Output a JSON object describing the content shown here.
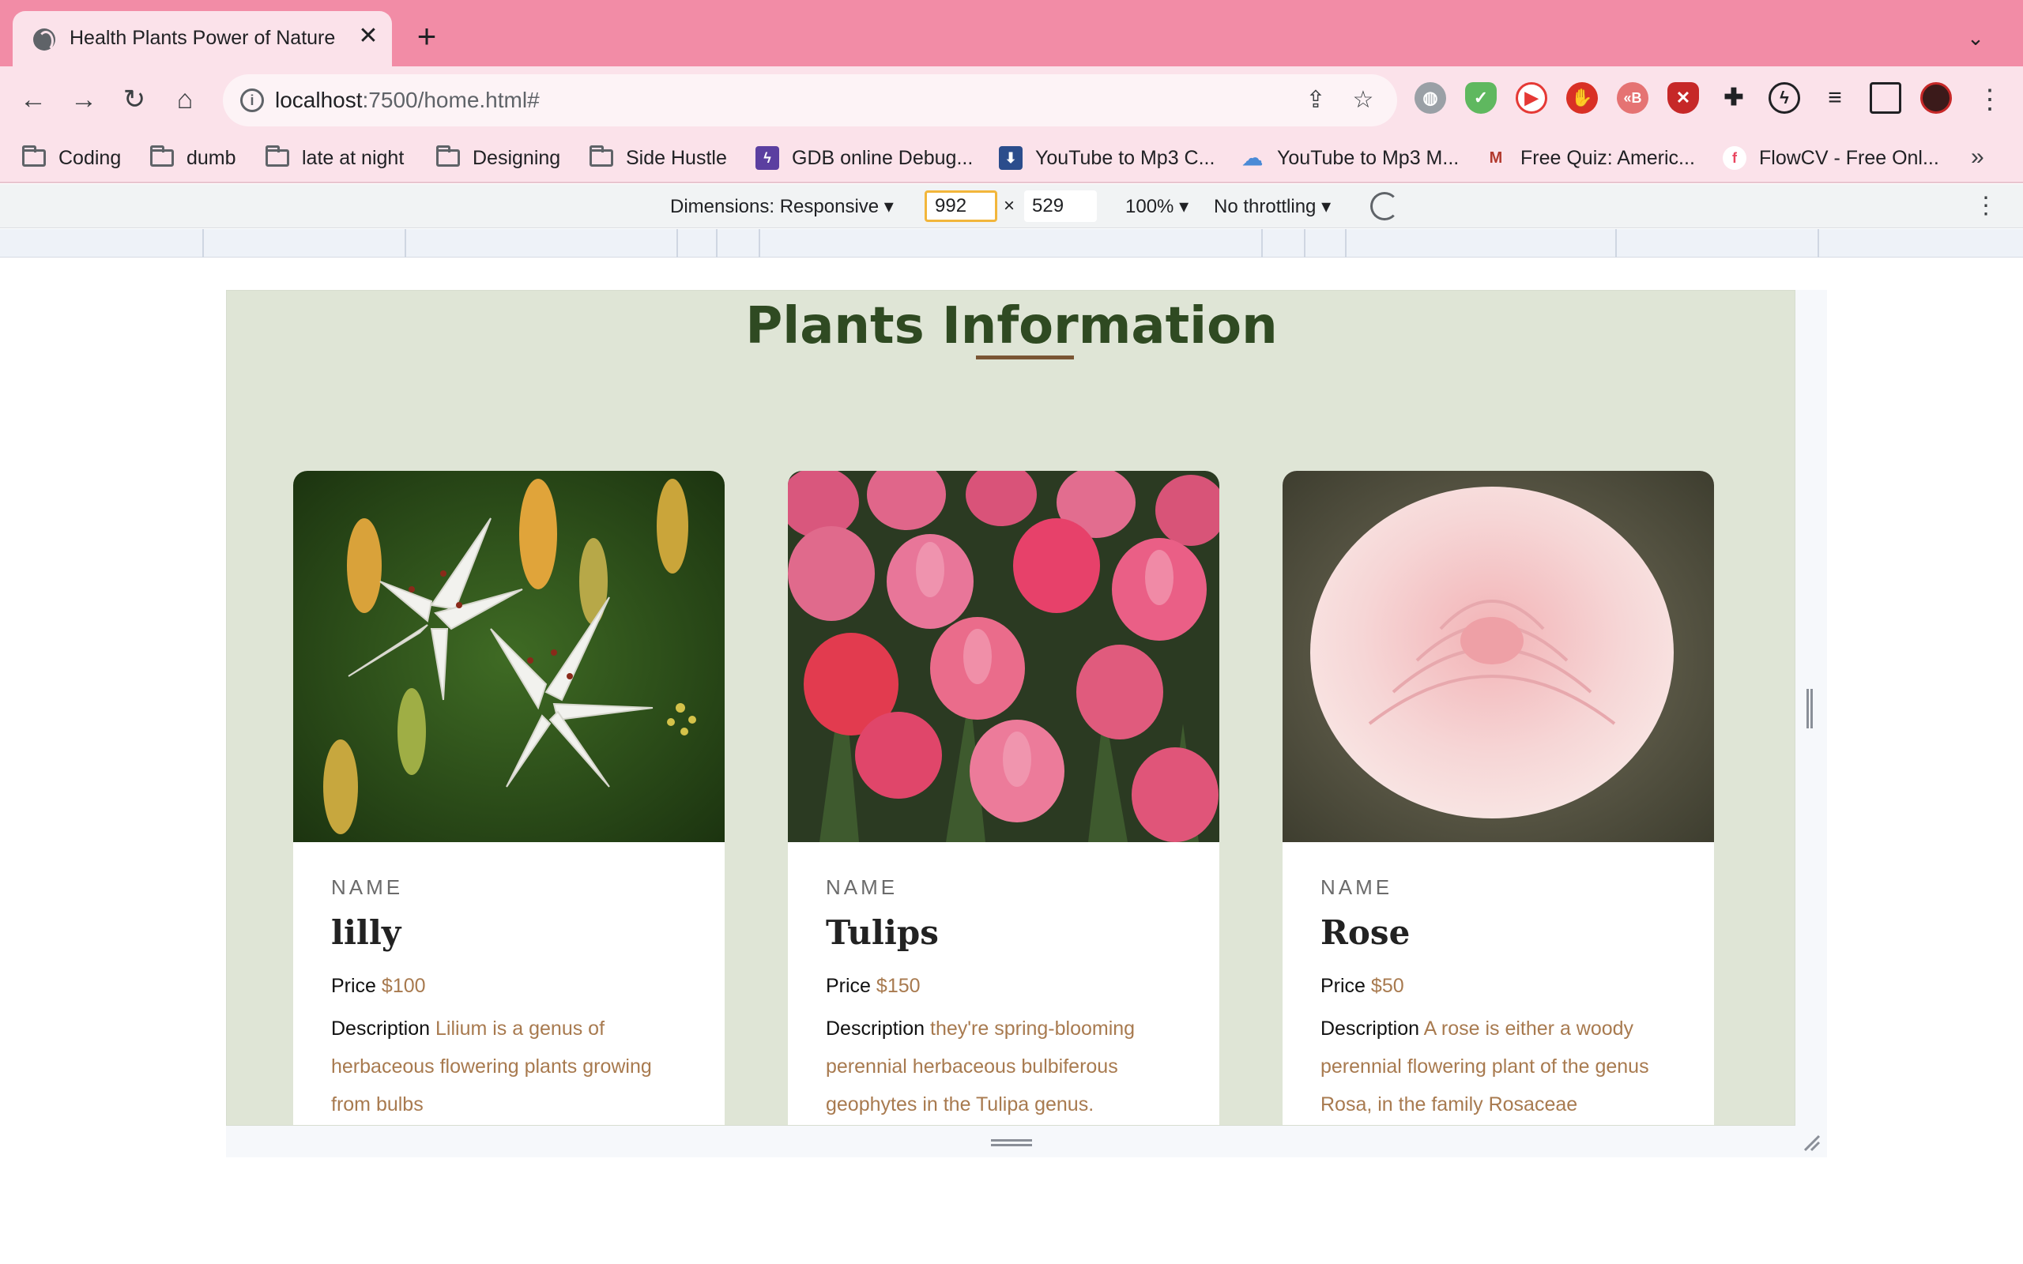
{
  "browser": {
    "tab_title": "Health Plants Power of Nature",
    "tab_close": "✕",
    "new_tab": "+",
    "tab_search": "⌄",
    "url_host": "localhost",
    "url_rest": ":7500/home.html#",
    "bookmarks": [
      {
        "label": "Coding",
        "icon": "folder-icon"
      },
      {
        "label": "dumb",
        "icon": "folder-icon"
      },
      {
        "label": "late at night",
        "icon": "folder-icon"
      },
      {
        "label": "Designing",
        "icon": "folder-icon"
      },
      {
        "label": "Side Hustle",
        "icon": "folder-icon"
      },
      {
        "label": "GDB online Debug...",
        "icon": "gdb-icon"
      },
      {
        "label": "YouTube to Mp3 C...",
        "icon": "download-icon"
      },
      {
        "label": "YouTube to Mp3 M...",
        "icon": "cloud-download-icon"
      },
      {
        "label": "Free Quiz: Americ...",
        "icon": "quiz-icon"
      },
      {
        "label": "FlowCV - Free Onl...",
        "icon": "flowcv-icon"
      }
    ],
    "bookmarks_overflow": "»"
  },
  "devtools": {
    "dimensions_label": "Dimensions: Responsive",
    "width": "992",
    "times": "×",
    "height": "529",
    "zoom": "100%",
    "throttling": "No throttling"
  },
  "page": {
    "title": "Plants Information",
    "cards": [
      {
        "label": "NAME",
        "name": "lilly",
        "price_label": "Price",
        "price": "$100",
        "description_label": "Description",
        "description": "Lilium is a genus of herbaceous flowering plants growing from bulbs"
      },
      {
        "label": "NAME",
        "name": "Tulips",
        "price_label": "Price",
        "price": "$150",
        "description_label": "Description",
        "description": "they're spring-blooming perennial herbaceous bulbiferous geophytes in the Tulipa genus."
      },
      {
        "label": "NAME",
        "name": "Rose",
        "price_label": "Price",
        "price": "$50",
        "description_label": "Description",
        "description": "A rose is either a woody perennial flowering plant of the genus Rosa, in the family Rosaceae"
      }
    ]
  },
  "colors": {
    "tabstrip": "#f28ca6",
    "toolbar": "#fbe2ea",
    "page_bg": "#dfe5d6",
    "title": "#2f4a22",
    "accent": "#a87a4f"
  }
}
